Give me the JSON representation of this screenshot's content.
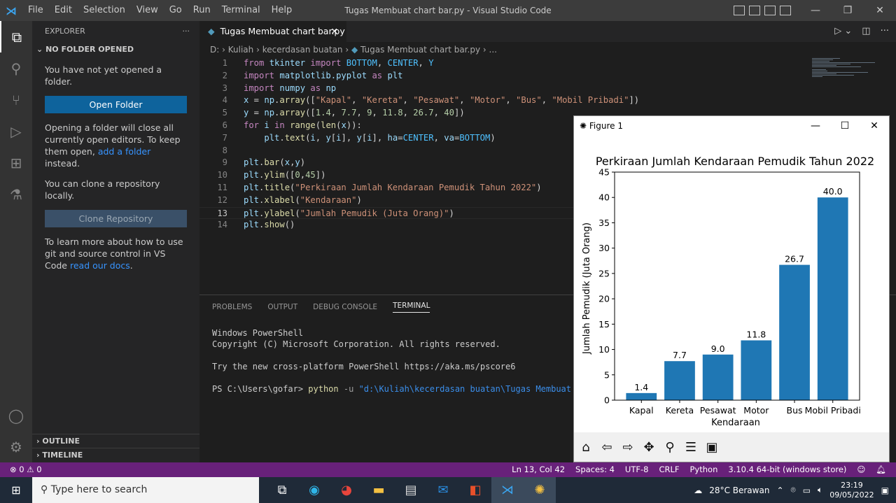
{
  "app": {
    "menu": [
      "File",
      "Edit",
      "Selection",
      "View",
      "Go",
      "Run",
      "Terminal",
      "Help"
    ],
    "window_title": "Tugas Membuat chart bar.py - Visual Studio Code"
  },
  "sidebar": {
    "title": "EXPLORER",
    "more": "···",
    "section": "NO FOLDER OPENED",
    "msg1": "You have not yet opened a folder.",
    "open_folder": "Open Folder",
    "msg2": "Opening a folder will close all currently open editors. To keep them open,",
    "add_folder_link": "add a folder",
    "msg2_end": "instead.",
    "msg3": "You can clone a repository locally.",
    "clone_repo": "Clone Repository",
    "msg4": "To learn more about how to use git and source control in VS Code",
    "read_docs_link": "read our docs",
    "msg4_end": ".",
    "outline": "OUTLINE",
    "timeline": "TIMELINE"
  },
  "editor": {
    "tab_label": "Tugas Membuat chart bar.py",
    "breadcrumb": [
      "D:",
      "Kuliah",
      "kecerdasan buatan",
      "Tugas Membuat chart bar.py",
      "..."
    ],
    "current_line": 13
  },
  "panel": {
    "tabs": [
      "PROBLEMS",
      "OUTPUT",
      "DEBUG CONSOLE",
      "TERMINAL"
    ],
    "active_tab": "TERMINAL",
    "terminal_lines": [
      "Windows PowerShell",
      "Copyright (C) Microsoft Corporation. All rights reserved.",
      "",
      "Try the new cross-platform PowerShell https://aka.ms/pscore6",
      ""
    ],
    "prompt": "PS C:\\Users\\gofar>",
    "command": "python",
    "flag": "-u",
    "arg": "\"d:\\Kuliah\\kecerdasan buatan\\Tugas Membuat chart b"
  },
  "figure": {
    "window_title": "Figure 1"
  },
  "chart_data": {
    "type": "bar",
    "title": "Perkiraan Jumlah Kendaraan Pemudik Tahun 2022",
    "xlabel": "Kendaraan",
    "ylabel": "Jumlah Pemudik (Juta Orang)",
    "categories": [
      "Kapal",
      "Kereta",
      "Pesawat",
      "Motor",
      "Bus",
      "Mobil Pribadi"
    ],
    "values": [
      1.4,
      7.7,
      9.0,
      11.8,
      26.7,
      40.0
    ],
    "data_labels": [
      "1.4",
      "7.7",
      "9.0",
      "11.8",
      "26.7",
      "40.0"
    ],
    "ylim": [
      0,
      45
    ],
    "yticks": [
      0,
      5,
      10,
      15,
      20,
      25,
      30,
      35,
      40,
      45
    ],
    "bar_color": "#1f77b4",
    "grid": false
  },
  "statusbar": {
    "errors": "⊗ 0 ⚠ 0",
    "position": "Ln 13, Col 42",
    "spaces": "Spaces: 4",
    "encoding": "UTF-8",
    "eol": "CRLF",
    "language": "Python",
    "interpreter": "3.10.4 64-bit (windows store)"
  },
  "taskbar": {
    "search_placeholder": "Type here to search",
    "weather": "28°C  Berawan",
    "time": "23:19",
    "date": "09/05/2022"
  }
}
